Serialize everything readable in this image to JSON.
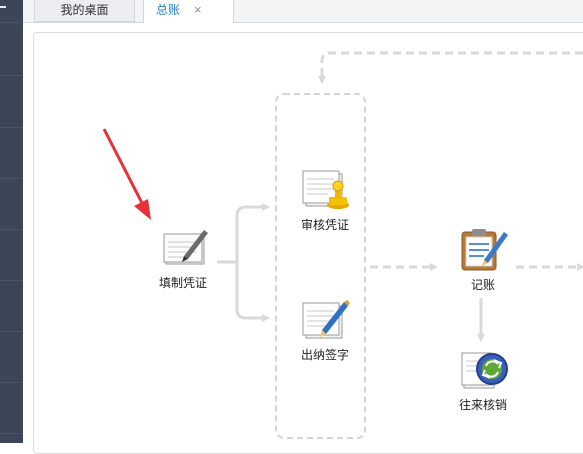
{
  "tabs": [
    {
      "label": "我的桌面",
      "active": false
    },
    {
      "label": "总账",
      "active": true,
      "close": "×"
    }
  ],
  "flow": {
    "fill_voucher": {
      "label": "填制凭证",
      "icon": "fill-voucher-icon"
    },
    "audit_voucher": {
      "label": "审核凭证",
      "icon": "audit-voucher-icon"
    },
    "cashier_sign": {
      "label": "出纳签字",
      "icon": "cashier-sign-icon"
    },
    "post_ledger": {
      "label": "记账",
      "icon": "post-ledger-icon"
    },
    "write_off": {
      "label": "往来核销",
      "icon": "write-off-icon"
    }
  },
  "annotation": {
    "color": "#e8303a",
    "icon": "red-arrow-pointer"
  },
  "colors": {
    "active_tab": "#2d7fc1",
    "sidebar": "#3c4658",
    "connector": "#d9d9d9"
  }
}
